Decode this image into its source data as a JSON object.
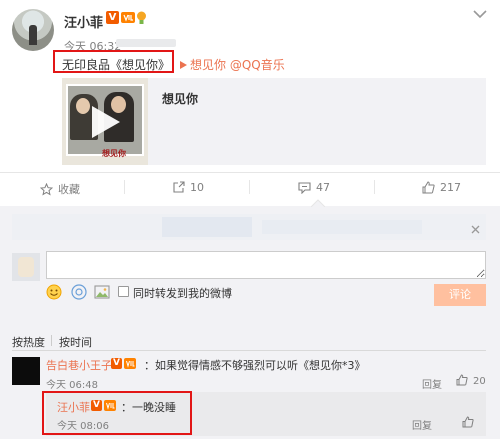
{
  "post": {
    "author": "汪小菲",
    "verified_badge": "V",
    "time": "今天 06:32",
    "text_prefix": "无印良品《想见你》",
    "music_link": "想见你 @QQ音乐",
    "card": {
      "title": "想见你",
      "cover_caption": "想见你"
    }
  },
  "actions": {
    "favorite": "收藏",
    "repost_count": "10",
    "comment_count": "47",
    "like_count": "217"
  },
  "composer": {
    "input_value": "",
    "repost_label": "同时转发到我的微博",
    "submit_label": "评论"
  },
  "sort": {
    "by_hot": "按热度",
    "by_time": "按时间"
  },
  "comment": {
    "user": "告白巷小王子",
    "verified_badge": "V",
    "text": "：如果觉得情感不够强烈可以听《想见你*3》",
    "time": "今天 06:48",
    "reply_label": "回复",
    "like_count": "20"
  },
  "reply": {
    "user": "汪小菲",
    "verified_badge": "V",
    "text": "：一晚没睡",
    "time": "今天 08:06",
    "reply_label": "回复"
  },
  "colors": {
    "accent": "#eb7350",
    "verify": "#f25c00",
    "highlight_box": "#e21616",
    "panel": "#f2f2f5",
    "submit_disabled": "#ffc09f"
  },
  "icons": [
    "chevron-down-icon",
    "vip-badge-icon",
    "lightbulb-icon",
    "play-icon",
    "star-icon",
    "repost-icon",
    "comment-icon",
    "thumbs-up-icon",
    "close-icon",
    "emoji-icon",
    "topic-icon",
    "image-icon"
  ]
}
